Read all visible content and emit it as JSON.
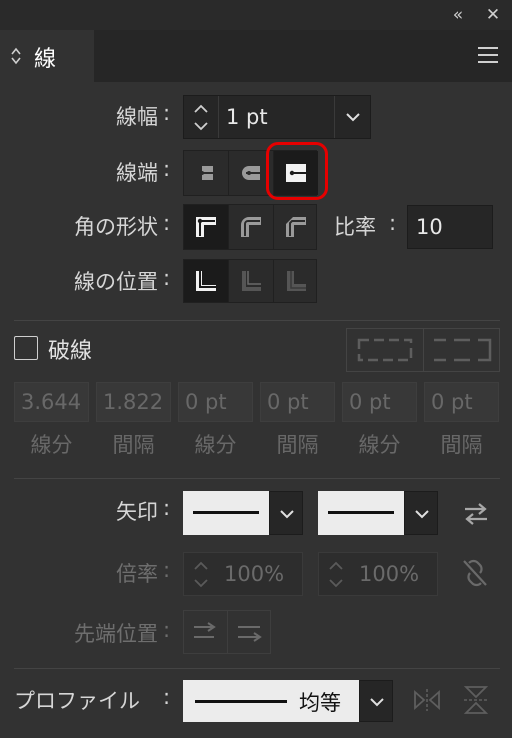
{
  "window": {
    "collapse_glyph": "«",
    "close_glyph": "✕"
  },
  "panel": {
    "title": "線"
  },
  "stroke_weight": {
    "label": "線幅",
    "value": "1 pt"
  },
  "caps": {
    "label": "線端",
    "options": [
      "butt-cap-icon",
      "round-cap-icon",
      "projecting-cap-icon"
    ],
    "selected_index": 2,
    "highlight_color": "#e60000"
  },
  "corners": {
    "label": "角の形状",
    "options": [
      "miter-join-icon",
      "round-join-icon",
      "bevel-join-icon"
    ],
    "selected_index": 0
  },
  "miter": {
    "label": "比率",
    "value": "10"
  },
  "align": {
    "label": "線の位置",
    "options": [
      "align-center-icon",
      "align-inside-icon",
      "align-outside-icon"
    ],
    "selected_index": 0
  },
  "dashed": {
    "label": "破線",
    "checked": false
  },
  "dash_fields": [
    {
      "value": "3.644",
      "label": "線分"
    },
    {
      "value": "1.822",
      "label": "間隔"
    },
    {
      "value": "0 pt",
      "label": "線分"
    },
    {
      "value": "0 pt",
      "label": "間隔"
    },
    {
      "value": "0 pt",
      "label": "線分"
    },
    {
      "value": "0 pt",
      "label": "間隔"
    }
  ],
  "arrowheads": {
    "label": "矢印"
  },
  "scale": {
    "label": "倍率",
    "start": "100%",
    "end": "100%"
  },
  "tip_position": {
    "label": "先端位置"
  },
  "profile": {
    "label": "プロファイル",
    "value": "均等"
  },
  "colors": {
    "panel_bg": "#323232",
    "field_bg": "#262626",
    "active_bg": "#1b1b1b",
    "highlight": "#e60000"
  }
}
